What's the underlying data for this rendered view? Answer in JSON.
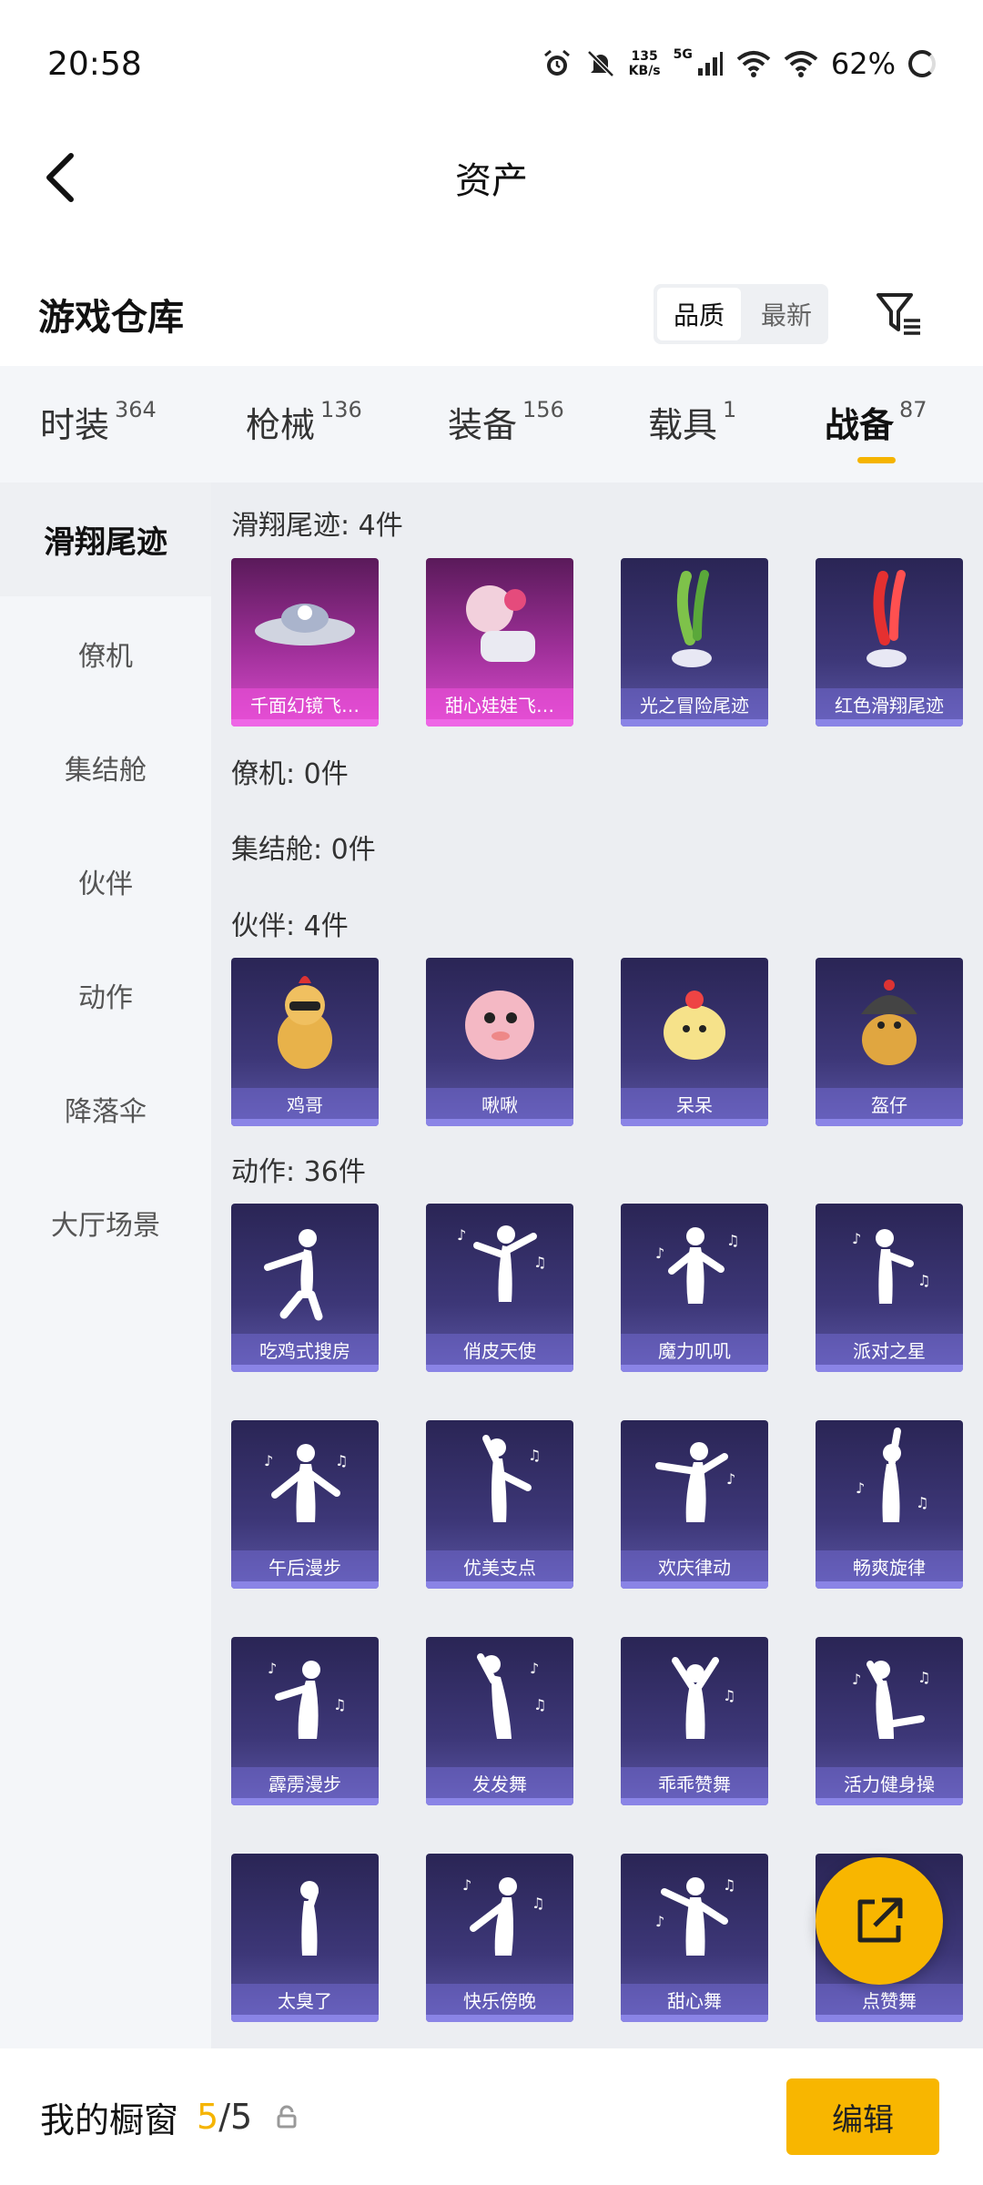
{
  "status": {
    "time": "20:58",
    "net_speed_value": "135",
    "net_speed_unit": "KB/s",
    "network": "5G",
    "battery": "62%"
  },
  "header": {
    "title": "资产"
  },
  "warehouse": {
    "title": "游戏仓库",
    "sort_options": [
      "品质",
      "最新"
    ],
    "sort_selected": "品质"
  },
  "tabs": [
    {
      "label": "时装",
      "count": "364"
    },
    {
      "label": "枪械",
      "count": "136"
    },
    {
      "label": "装备",
      "count": "156"
    },
    {
      "label": "载具",
      "count": "1"
    },
    {
      "label": "战备",
      "count": "87",
      "active": true
    }
  ],
  "sidebar": {
    "items": [
      "滑翔尾迹",
      "僚机",
      "集结舱",
      "伙伴",
      "动作",
      "降落伞",
      "大厅场景"
    ],
    "selected": "滑翔尾迹"
  },
  "sections": {
    "glide": {
      "title": "滑翔尾迹: 4件",
      "items": [
        "千面幻镜飞…",
        "甜心娃娃飞…",
        "光之冒险尾迹",
        "红色滑翔尾迹"
      ]
    },
    "wingman": {
      "title": "僚机: 0件"
    },
    "pod": {
      "title": "集结舱: 0件"
    },
    "partner": {
      "title": "伙伴: 4件",
      "items": [
        "鸡哥",
        "啾啾",
        "呆呆",
        "盔仔"
      ]
    },
    "emote": {
      "title": "动作: 36件",
      "items": [
        "吃鸡式搜房",
        "俏皮天使",
        "魔力叽叽",
        "派对之星",
        "午后漫步",
        "优美支点",
        "欢庆律动",
        "畅爽旋律",
        "霹雳漫步",
        "发发舞",
        "乖乖赞舞",
        "活力健身操",
        "太臭了",
        "快乐傍晚",
        "甜心舞",
        "点赞舞"
      ]
    }
  },
  "bottom": {
    "label": "我的橱窗",
    "current": "5",
    "separator": "/",
    "max": "5",
    "edit_label": "编辑"
  },
  "colors": {
    "accent": "#f8b600",
    "tile_purple": "#3d3778",
    "tile_pink": "#d84ccc"
  }
}
